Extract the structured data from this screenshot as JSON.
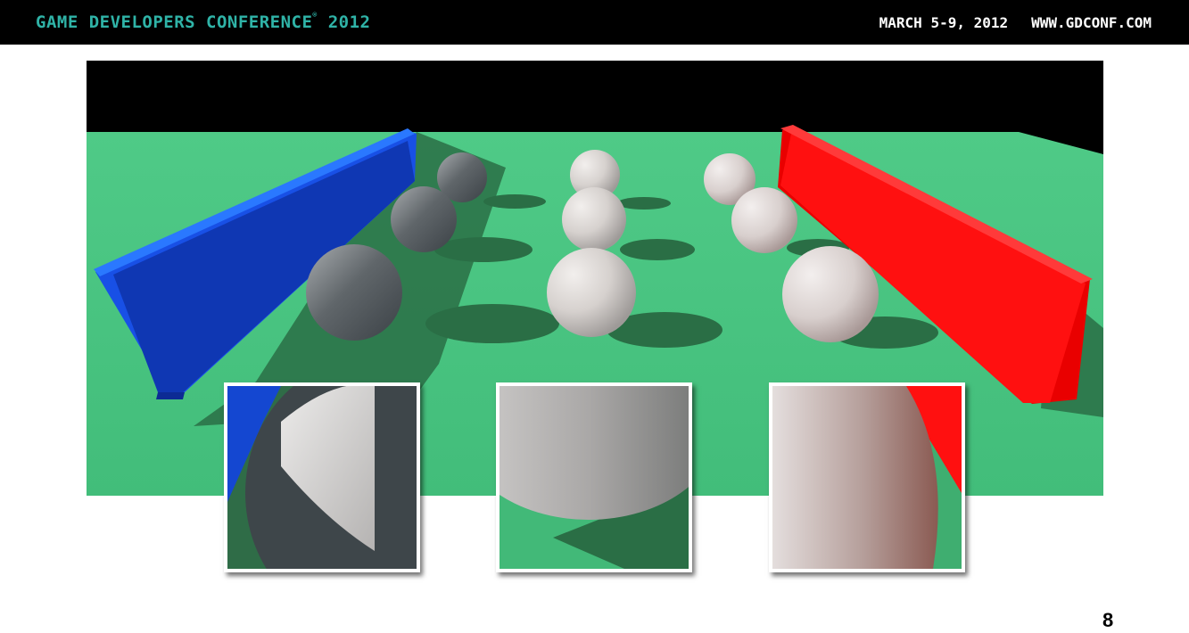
{
  "header": {
    "conference_title": "GAME DEVELOPERS CONFERENCE",
    "registered_mark": "®",
    "year": "2012",
    "dates": "MARCH 5-9, 2012",
    "website": "WWW.GDCONF.COM",
    "title_color": "#2fb3a7"
  },
  "scene": {
    "floor_color": "#45c07e",
    "background_color": "#000000",
    "left_wall_color": "#1244d6",
    "right_wall_color": "#ff0000",
    "sphere_color": "#d9d4d1"
  },
  "insets": [
    {
      "name": "left-closeup",
      "wall_color": "#1244d6"
    },
    {
      "name": "center-closeup",
      "wall_color": "none"
    },
    {
      "name": "right-closeup",
      "wall_color": "#ff0000"
    }
  ],
  "footer": {
    "page_number": "8"
  }
}
